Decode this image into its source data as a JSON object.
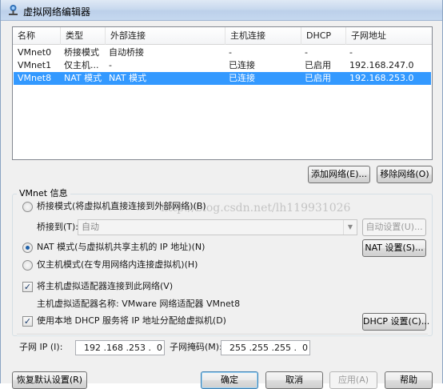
{
  "window": {
    "title": "虚拟网络编辑器"
  },
  "network_table": {
    "columns": [
      "名称",
      "类型",
      "外部连接",
      "主机连接",
      "DHCP",
      "子网地址"
    ],
    "rows": [
      {
        "name": "VMnet0",
        "type": "桥接模式",
        "external": "自动桥接",
        "host": "-",
        "dhcp": "-",
        "subnet": "-"
      },
      {
        "name": "VMnet1",
        "type": "仅主机...",
        "external": "-",
        "host": "已连接",
        "dhcp": "已启用",
        "subnet": "192.168.247.0"
      },
      {
        "name": "VMnet8",
        "type": "NAT 模式",
        "external": "NAT 模式",
        "host": "已连接",
        "dhcp": "已启用",
        "subnet": "192.168.253.0"
      }
    ]
  },
  "list_buttons": {
    "add": "添加网络(E)...",
    "remove": "移除网络(O)"
  },
  "vmnet_info": {
    "group_title": "VMnet 信息",
    "bridged_label": "桥接模式(将虚拟机直接连接到外部网络)(B)",
    "bridged_to_label": "桥接到(T):",
    "bridged_to_value": "自动",
    "auto_settings": "自动设置(U)...",
    "nat_label": "NAT 模式(与虚拟机共享主机的 IP 地址)(N)",
    "nat_settings": "NAT 设置(S)...",
    "hostonly_label": "仅主机模式(在专用网络内连接虚拟机)(H)",
    "connect_adapter_label": "将主机虚拟适配器连接到此网络(V)",
    "adapter_name_label": "主机虚拟适配器名称: VMware 网络适配器 VMnet8",
    "dhcp_label": "使用本地 DHCP 服务将 IP 地址分配给虚拟机(D)",
    "dhcp_settings": "DHCP 设置(C)...",
    "subnet_ip_label": "子网 IP (I):",
    "subnet_ip_value": "192 .168 .253 .  0",
    "subnet_mask_label": "子网掩码(M):",
    "subnet_mask_value": "255 .255 .255 .  0"
  },
  "state": {
    "selected_mode": "nat",
    "connect_adapter_checked": true,
    "dhcp_checked": true
  },
  "watermark": "http://blog.csdn.net/lh1199310​26",
  "footer_buttons": {
    "restore": "恢复默认设置(R)",
    "ok": "确定",
    "cancel": "取消",
    "apply": "应用(A)",
    "help": "帮助"
  },
  "colors": {
    "selection": "#3399ff",
    "title_bar": "#c8d9ee"
  }
}
